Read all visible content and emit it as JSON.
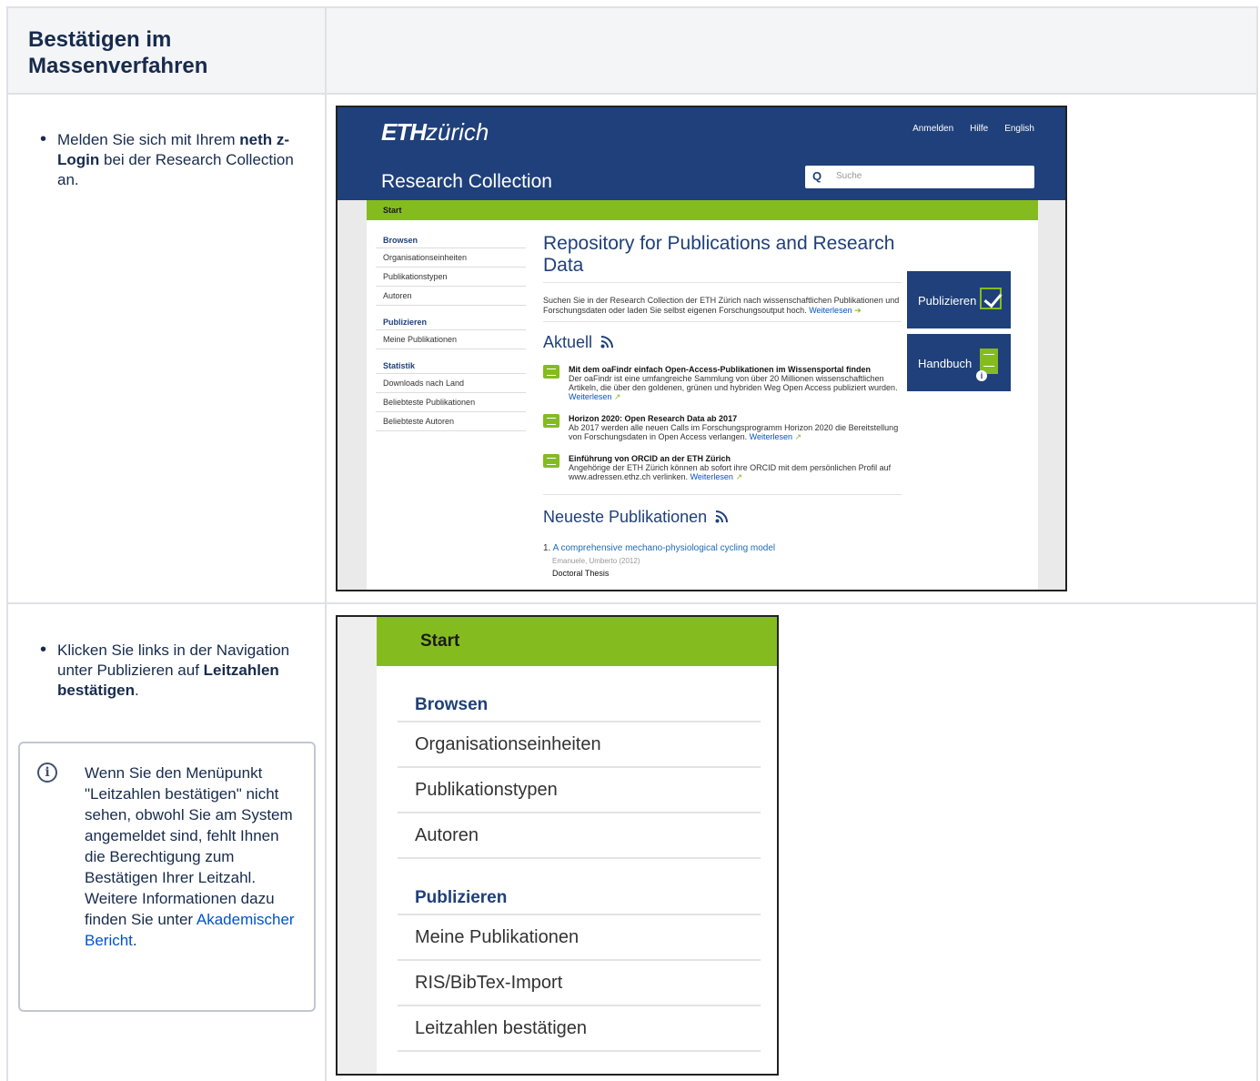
{
  "table": {
    "header_title": "Bestätigen im Massenverfahren",
    "row1": {
      "text_pre": "Melden Sie sich mit Ihrem ",
      "text_bold": "neth z-Login",
      "text_post": " bei der Research Collection an."
    },
    "row2": {
      "text_pre": "Klicken Sie links in der Navigation unter Publizieren auf ",
      "text_bold": "Leitzahlen bestätigen",
      "text_post": ".",
      "info_text": "Wenn Sie den Menüpunkt \"Leitzahlen bestätigen\" nicht sehen, obwohl Sie am System angemeldet sind, fehlt Ihnen die Berechtigung zum Bestätigen Ihrer Leitzahl. Weitere Informationen dazu finden Sie unter ",
      "info_link": "Akademischer Bericht",
      "info_end": ".",
      "info_icon": "info-icon"
    }
  },
  "eth": {
    "logo_bold": "ETH",
    "logo_rest": "zürich",
    "links": [
      "Anmelden",
      "Hilfe",
      "English"
    ],
    "site_title": "Research Collection",
    "search_placeholder": "Suche",
    "breadcrumb": "Start",
    "nav": {
      "browse_heading": "Browsen",
      "browse_items": [
        "Organisationseinheiten",
        "Publikationstypen",
        "Autoren"
      ],
      "publish_heading": "Publizieren",
      "publish_items": [
        "Meine Publikationen"
      ],
      "stats_heading": "Statistik",
      "stats_items": [
        "Downloads nach Land",
        "Beliebteste Publikationen",
        "Beliebteste Autoren"
      ]
    },
    "repo_heading": "Repository for Publications and Research Data",
    "intro": "Suchen Sie in der Research Collection der ETH Zürich nach wissenschaftlichen Publikationen und Forschungsdaten oder laden Sie selbst eigenen Forschungsoutput hoch.",
    "read_more": "Weiterlesen",
    "aktuell_heading": "Aktuell",
    "news": [
      {
        "title": "Mit dem oaFindr einfach Open-Access-Publikationen im Wissensportal finden",
        "body": "Der oaFindr ist eine umfangreiche Sammlung von über 20 Millionen wissenschaftlichen Artikeln, die über den goldenen, grünen und hybriden Weg Open Access publiziert wurden.",
        "link": "Weiterlesen"
      },
      {
        "title": "Horizon 2020: Open Research Data ab 2017",
        "body": "Ab 2017 werden alle neuen Calls im Forschungsprogramm Horizon 2020 die Bereitstellung von Forschungsdaten in Open Access verlangen.",
        "link": "Weiterlesen"
      },
      {
        "title": "Einführung von ORCID an der ETH Zürich",
        "body": "Angehörige der ETH Zürich können ab sofort ihre ORCID mit dem persönlichen Profil auf www.adressen.ethz.ch verlinken.",
        "link": "Weiterlesen"
      }
    ],
    "latest_heading": "Neueste Publikationen",
    "pub_number": "1.",
    "pub_title": "A comprehensive mechano-physiological cycling model",
    "pub_meta": "Emanuele, Umberto (2012)",
    "pub_type": "Doctoral Thesis",
    "btn_publish": "Publizieren",
    "btn_manual": "Handbuch",
    "accent": "#84bc1f",
    "brand": "#1f407a"
  },
  "nav_zoom": {
    "breadcrumb": "Start",
    "browse_heading": "Browsen",
    "browse_items": [
      "Organisationseinheiten",
      "Publikationstypen",
      "Autoren"
    ],
    "publish_heading": "Publizieren",
    "publish_items": [
      "Meine Publikationen",
      "RIS/BibTex-Import",
      "Leitzahlen bestätigen"
    ]
  }
}
